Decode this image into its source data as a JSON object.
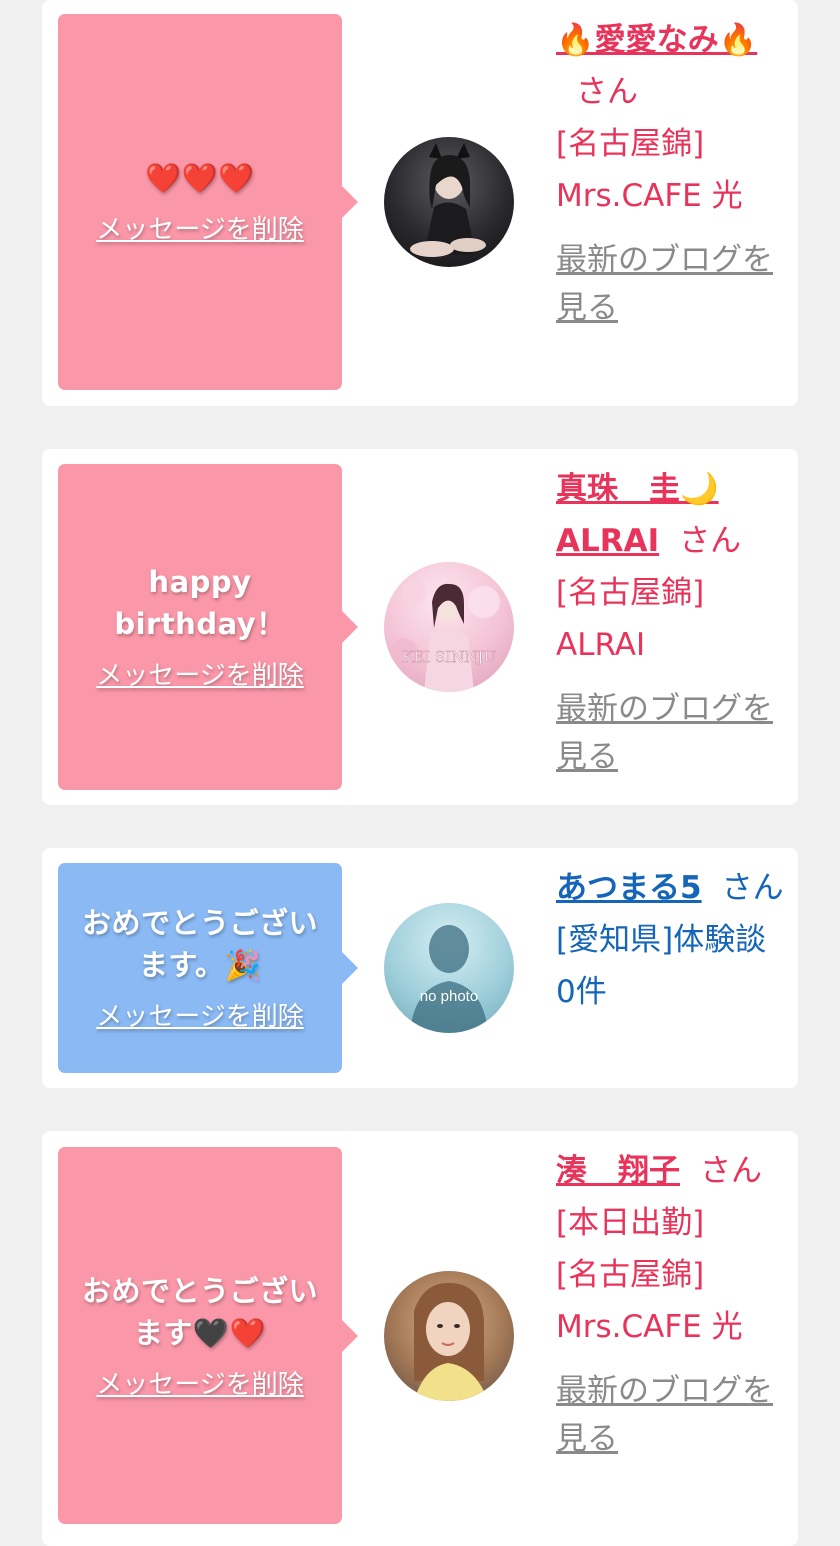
{
  "cards": [
    {
      "message": "❤️❤️❤️",
      "delete_label": "メッセージを削除",
      "name": "🔥愛愛なみ🔥",
      "san": "さん",
      "shop": "[名古屋錦] Mrs.CAFE 光",
      "blog_label": "最新のブログを見る",
      "bubble_color": "#fa97a8"
    },
    {
      "message": "happy birthday！",
      "delete_label": "メッセージを削除",
      "name": "真珠　圭🌙ALRAI",
      "san": "さん",
      "shop": "[名古屋錦] ALRAI",
      "blog_label": "最新のブログを見る",
      "bubble_color": "#fa97a8",
      "avatar_caption": "KEI SINNJU"
    },
    {
      "message": "おめでとうございます。🎉",
      "delete_label": "メッセージを削除",
      "name": "あつまる5",
      "san": "さん",
      "shop": "[愛知県]体験談 0件",
      "bubble_color": "#8ab9f4",
      "avatar_caption": "no photo"
    },
    {
      "message": "おめでとうございます🖤❤️",
      "delete_label": "メッセージを削除",
      "name": "湊　翔子",
      "san": "さん",
      "status": "[本日出勤]",
      "shop": "[名古屋錦] Mrs.CAFE 光",
      "blog_label": "最新のブログを見る",
      "bubble_color": "#fa97a8"
    }
  ],
  "colors": {
    "accent_pink": "#e8335a",
    "accent_blue": "#1565b8",
    "link_gray": "#8a8a8a"
  }
}
